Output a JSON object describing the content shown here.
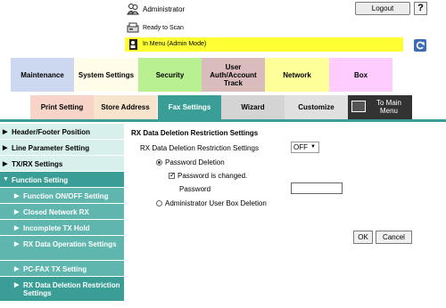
{
  "header": {
    "user": "Administrator",
    "logout_label": "Logout",
    "help_label": "?",
    "status": "Ready to Scan",
    "mode": "In Menu (Admin Mode)"
  },
  "main_tabs": [
    {
      "label": "Maintenance"
    },
    {
      "label": "System Settings"
    },
    {
      "label": "Security"
    },
    {
      "label": "User Auth/Account Track"
    },
    {
      "label": "Network"
    },
    {
      "label": "Box"
    }
  ],
  "sub_tabs": [
    {
      "label": "Print Setting"
    },
    {
      "label": "Store Address"
    },
    {
      "label": "Fax Settings"
    },
    {
      "label": "Wizard"
    },
    {
      "label": "Customize"
    },
    {
      "label": "To Main Menu"
    }
  ],
  "sidebar": {
    "items": [
      {
        "label": "Header/Footer Position"
      },
      {
        "label": "Line Parameter Setting"
      },
      {
        "label": "TX/RX Settings"
      },
      {
        "label": "Function Setting"
      },
      {
        "label": "Function ON/OFF Setting"
      },
      {
        "label": "Closed Network RX"
      },
      {
        "label": "Incomplete TX Hold"
      },
      {
        "label": "RX Data Operation Settings"
      },
      {
        "label": "PC-FAX TX Setting"
      },
      {
        "label": "RX Data Deletion Restriction Settings"
      }
    ]
  },
  "content": {
    "title": "RX Data Deletion Restriction Settings",
    "setting_label": "RX Data Deletion Restriction Settings",
    "setting_value": "OFF",
    "option_password": "Password Deletion",
    "password_changed": "Password is changed.",
    "password_label": "Password",
    "password_value": "",
    "option_admin": "Administrator User Box Deletion"
  },
  "buttons": {
    "ok": "OK",
    "cancel": "Cancel"
  },
  "colors": {
    "accent": "#3a9e96",
    "mode_bar": "#ffff33"
  }
}
